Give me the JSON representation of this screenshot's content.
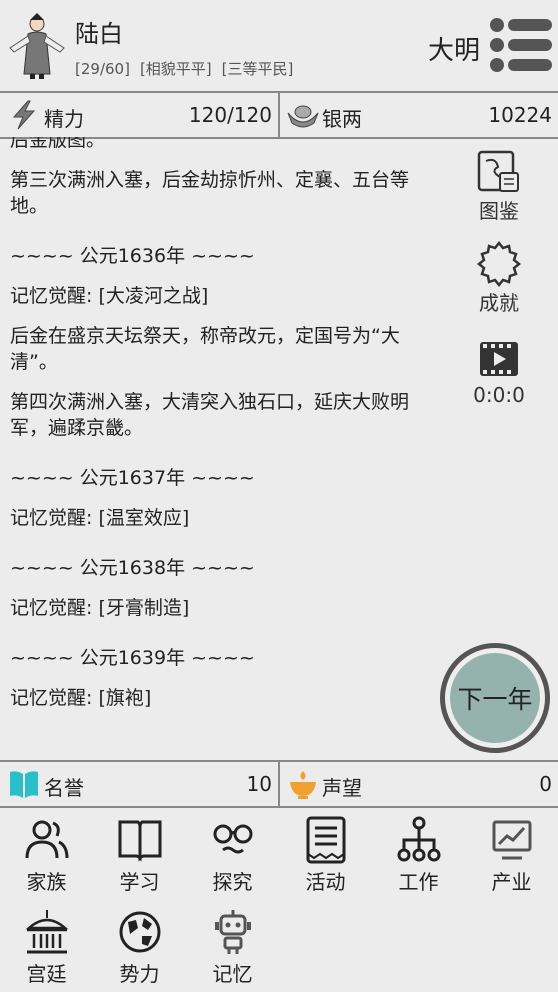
{
  "profile": {
    "name": "陆白",
    "tags": [
      "[29/60]",
      "[相貌平平]",
      "[三等平民]"
    ],
    "dynasty": "大明"
  },
  "top_stats": {
    "energy": {
      "label": "精力",
      "value": "120/120"
    },
    "silver": {
      "label": "银两",
      "value": "10224"
    }
  },
  "log": {
    "partial_top": "后金版图。",
    "entries": [
      {
        "type": "text",
        "text": "第三次满洲入塞，后金劫掠忻州、定襄、五台等地。"
      },
      {
        "type": "year",
        "text": "~~~~ 公元1636年 ~~~~"
      },
      {
        "type": "text",
        "text": "记忆觉醒: [大凌河之战]"
      },
      {
        "type": "text",
        "text": "后金在盛京天坛祭天，称帝改元，定国号为“大清”。"
      },
      {
        "type": "text",
        "text": "第四次满洲入塞，大清突入独石口，延庆大败明军，遍蹂京畿。"
      },
      {
        "type": "year",
        "text": "~~~~ 公元1637年 ~~~~"
      },
      {
        "type": "text",
        "text": "记忆觉醒: [温室效应]"
      },
      {
        "type": "year",
        "text": "~~~~ 公元1638年 ~~~~"
      },
      {
        "type": "text",
        "text": "记忆觉醒: [牙膏制造]"
      },
      {
        "type": "year",
        "text": "~~~~ 公元1639年 ~~~~"
      },
      {
        "type": "text",
        "text": "记忆觉醒: [旗袍]"
      }
    ]
  },
  "side_menu": {
    "atlas": "图鉴",
    "achievement": "成就",
    "timer": "0:0:0"
  },
  "next_year_label": "下一年",
  "bottom_stats": {
    "fame": {
      "label": "名誉",
      "value": "10"
    },
    "prestige": {
      "label": "声望",
      "value": "0"
    }
  },
  "nav": [
    "家族",
    "学习",
    "探究",
    "活动",
    "工作",
    "产业",
    "宫廷",
    "势力",
    "记忆"
  ],
  "colors": {
    "background": "#ececec",
    "next_button": "#95b2ac",
    "fame_icon": "#2bbfc9",
    "prestige_icon": "#f0a030"
  }
}
